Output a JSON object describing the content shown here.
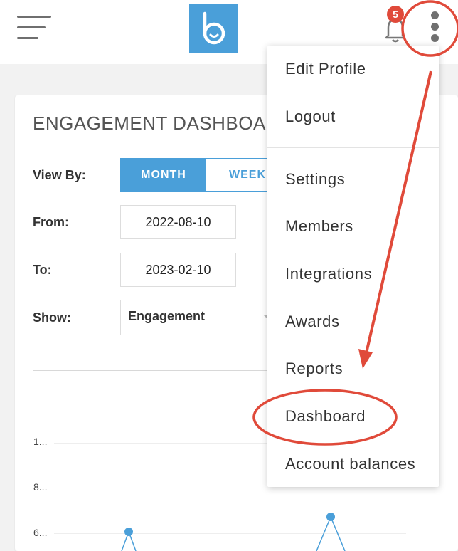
{
  "header": {
    "notification_count": "5",
    "icons": {
      "menu": "hamburger-icon",
      "logo": "logo-icon",
      "bell": "bell-icon",
      "more": "kebab-icon"
    }
  },
  "dashboard": {
    "title": "ENGAGEMENT DASHBOARD",
    "view_by_label": "View By:",
    "view_options": [
      "MONTH",
      "WEEK"
    ],
    "selected_view": "MONTH",
    "from_label": "From:",
    "from_value": "2022-08-10",
    "to_label": "To:",
    "to_value": "2023-02-10",
    "show_label": "Show:",
    "show_value": "Engagement",
    "y_ticks": [
      "1...",
      "8...",
      "6..."
    ]
  },
  "menu": {
    "items": [
      "Edit Profile",
      "Logout",
      "Settings",
      "Members",
      "Integrations",
      "Awards",
      "Reports",
      "Dashboard",
      "Account balances"
    ]
  },
  "colors": {
    "accent": "#4a9fd9",
    "annotation": "#e04a3a",
    "badge": "#e04a3a"
  }
}
